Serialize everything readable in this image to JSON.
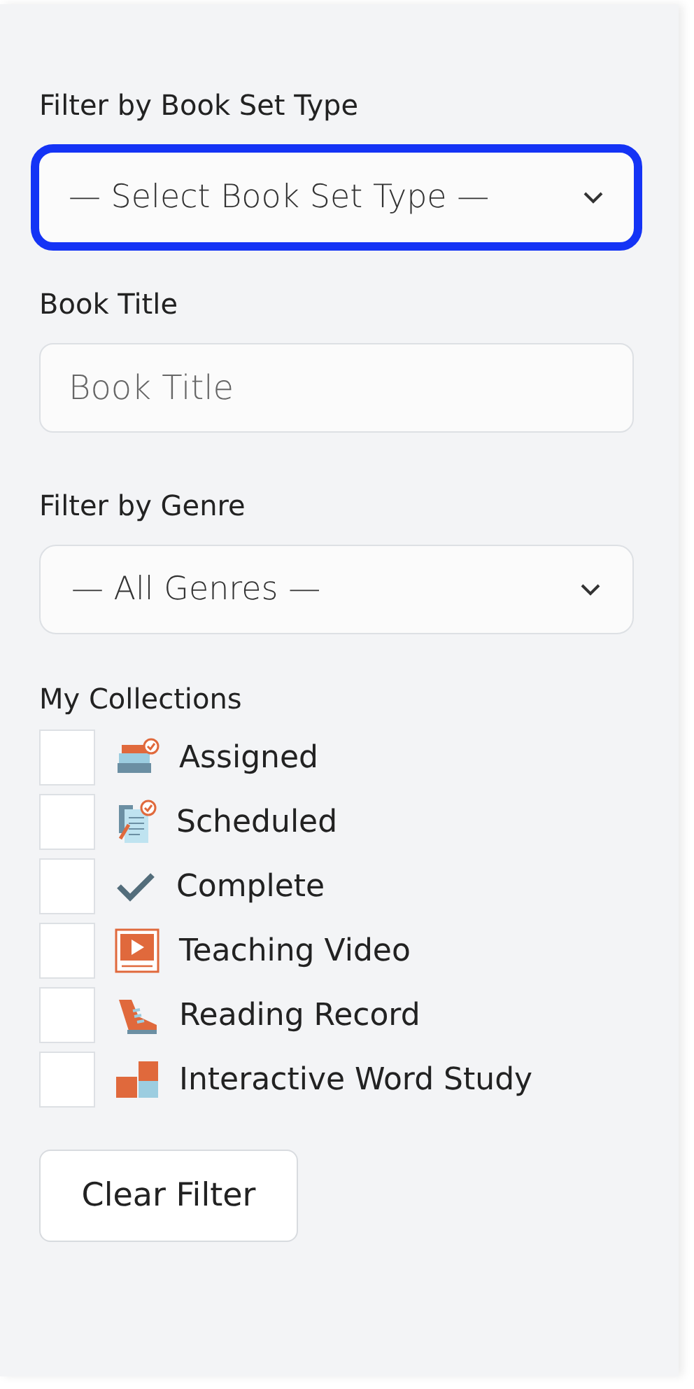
{
  "book_set_type": {
    "label": "Filter by Book Set Type",
    "value": "— Select Book Set Type —",
    "focused": true
  },
  "book_title": {
    "label": "Book Title",
    "placeholder": "Book Title"
  },
  "genre": {
    "label": "Filter by Genre",
    "value": "— All Genres —",
    "focused": false
  },
  "collections": {
    "label": "My Collections",
    "items": [
      {
        "label": "Assigned",
        "kind": "books",
        "checked": false
      },
      {
        "label": "Scheduled",
        "kind": "clipboard",
        "checked": false
      },
      {
        "label": "Complete",
        "kind": "check",
        "checked": false
      },
      {
        "label": "Teaching Video",
        "kind": "video",
        "checked": false
      },
      {
        "label": "Reading Record",
        "kind": "shoe",
        "checked": false
      },
      {
        "label": "Interactive Word Study",
        "kind": "blocks",
        "checked": false
      }
    ]
  },
  "clear_button": "Clear Filter"
}
